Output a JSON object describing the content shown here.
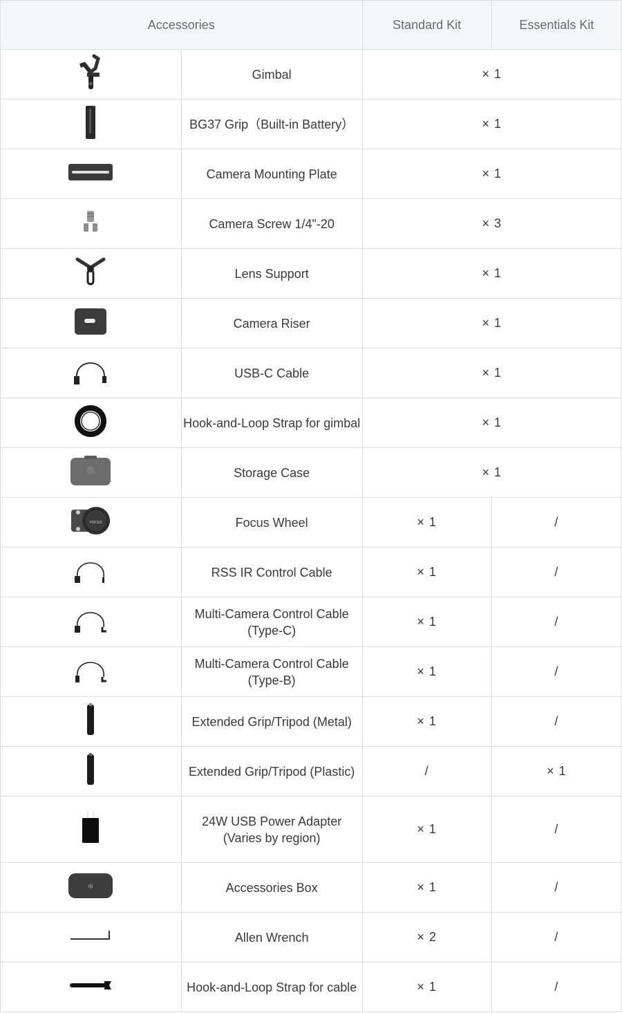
{
  "header": {
    "accessories": "Accessories",
    "standard_kit": "Standard Kit",
    "essentials_kit": "Essentials Kit"
  },
  "rows": [
    {
      "icon": "gimbal-icon",
      "name": "Gimbal",
      "shared": "× 1"
    },
    {
      "icon": "grip-icon",
      "name": "BG37 Grip（Built-in Battery）",
      "shared": "× 1"
    },
    {
      "icon": "mounting-plate-icon",
      "name": "Camera Mounting Plate",
      "shared": "× 1"
    },
    {
      "icon": "screw-icon",
      "name": "Camera Screw 1/4\"-20",
      "shared": "× 3"
    },
    {
      "icon": "lens-support-icon",
      "name": "Lens Support",
      "shared": "× 1"
    },
    {
      "icon": "camera-riser-icon",
      "name": "Camera Riser",
      "shared": "× 1"
    },
    {
      "icon": "usb-c-cable-icon",
      "name": "USB-C Cable",
      "shared": "× 1"
    },
    {
      "icon": "strap-roll-icon",
      "name": "Hook-and-Loop Strap for gimbal",
      "shared": "× 1"
    },
    {
      "icon": "storage-case-icon",
      "name": "Storage Case",
      "shared": "× 1"
    },
    {
      "icon": "focus-wheel-icon",
      "name": "Focus Wheel",
      "standard": "× 1",
      "essentials": "/"
    },
    {
      "icon": "rss-cable-icon",
      "name": "RSS IR Control Cable",
      "standard": "× 1",
      "essentials": "/"
    },
    {
      "icon": "multi-cam-cable-c-icon",
      "name": "Multi-Camera Control Cable (Type-C)",
      "standard": "× 1",
      "essentials": "/"
    },
    {
      "icon": "multi-cam-cable-b-icon",
      "name": "Multi-Camera Control Cable (Type-B)",
      "standard": "× 1",
      "essentials": "/"
    },
    {
      "icon": "tripod-metal-icon",
      "name": "Extended Grip/Tripod (Metal)",
      "standard": "× 1",
      "essentials": "/"
    },
    {
      "icon": "tripod-plastic-icon",
      "name": "Extended Grip/Tripod (Plastic)",
      "standard": "/",
      "essentials": "× 1"
    },
    {
      "icon": "power-adapter-icon",
      "name": "24W USB Power Adapter",
      "name_line2": "(Varies by region)",
      "standard": "× 1",
      "essentials": "/"
    },
    {
      "icon": "accessories-box-icon",
      "name": "Accessories Box",
      "standard": "× 1",
      "essentials": "/"
    },
    {
      "icon": "allen-wrench-icon",
      "name": "Allen Wrench",
      "standard": "× 2",
      "essentials": "/"
    },
    {
      "icon": "cable-strap-icon",
      "name": "Hook-and-Loop Strap for cable",
      "standard": "× 1",
      "essentials": "/"
    }
  ]
}
